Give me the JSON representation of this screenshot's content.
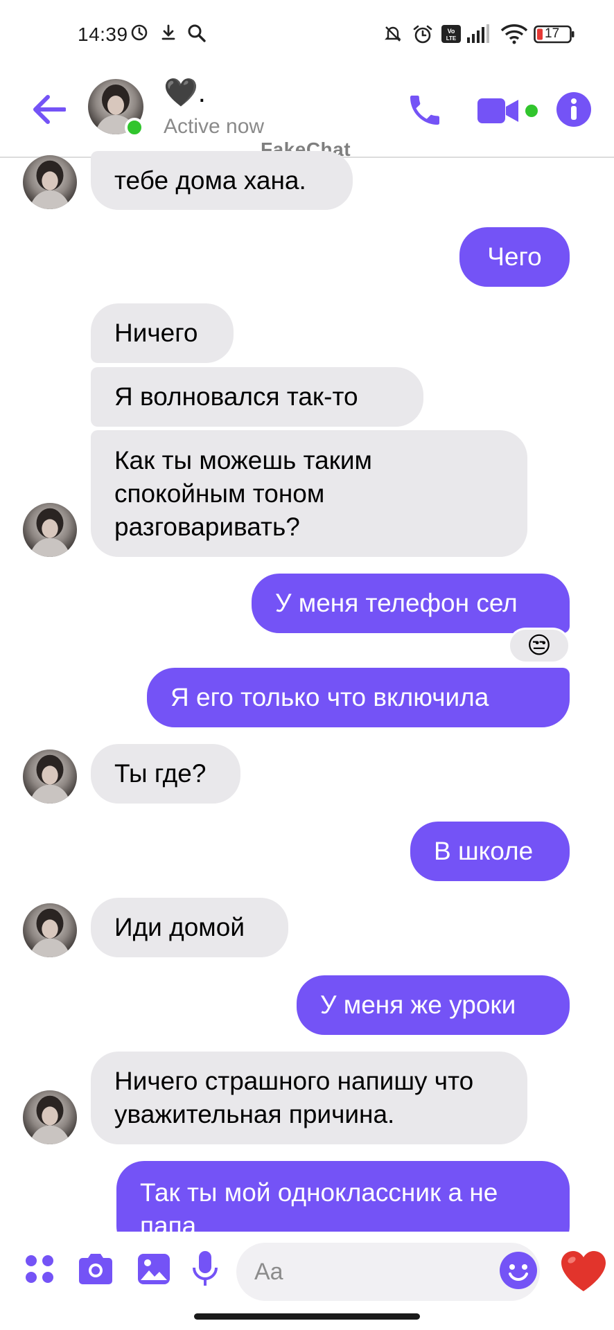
{
  "status_bar": {
    "time": "14:39",
    "battery": "17"
  },
  "header": {
    "contact_name": "🖤.",
    "contact_status": "Active now",
    "watermark": "FakeChat"
  },
  "messages": [
    {
      "dir": "in",
      "text": "тебе дома хана."
    },
    {
      "dir": "out",
      "text": "Чего"
    },
    {
      "dir": "in",
      "text": "Ничего"
    },
    {
      "dir": "in",
      "text": "Я волновался так-то"
    },
    {
      "dir": "in",
      "text": "Как ты можешь таким спокойным тоном разговаривать?"
    },
    {
      "dir": "out",
      "text": "У меня телефон сел",
      "reaction": "😒"
    },
    {
      "dir": "out",
      "text": "Я его только что включила"
    },
    {
      "dir": "in",
      "text": "Ты где?"
    },
    {
      "dir": "out",
      "text": "В школе"
    },
    {
      "dir": "in",
      "text": "Иди домой"
    },
    {
      "dir": "out",
      "text": "У меня же уроки"
    },
    {
      "dir": "in",
      "text": "Ничего страшного напишу что уважительная причина."
    },
    {
      "dir": "out",
      "text": "Так ты мой одноклассник а не папа"
    }
  ],
  "composer": {
    "placeholder": "Aa",
    "like_emoji": "❤️"
  },
  "colors": {
    "accent": "#7453f6",
    "incoming_bubble": "#e9e8eb",
    "online": "#31c52d"
  },
  "icons": [
    "back-arrow-icon",
    "phone-icon",
    "video-camera-icon",
    "info-icon",
    "apps-icon",
    "camera-icon",
    "gallery-icon",
    "microphone-icon",
    "emoji-icon",
    "heart-icon"
  ]
}
